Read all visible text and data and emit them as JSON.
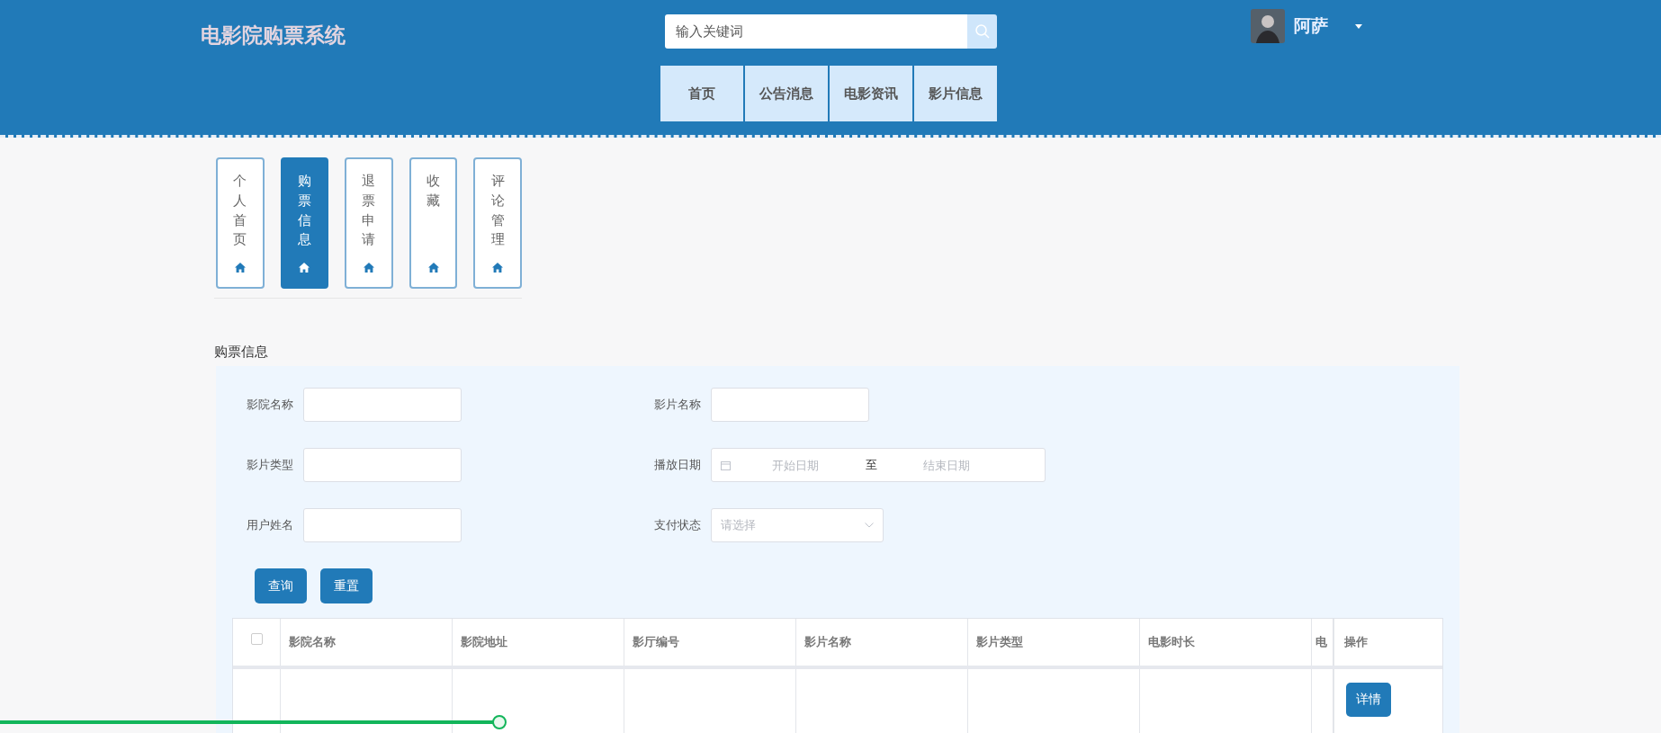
{
  "header": {
    "title": "电影院购票系统",
    "search": {
      "placeholder": "输入关键词"
    },
    "user": {
      "name": "阿萨"
    },
    "nav": [
      {
        "label": "首页"
      },
      {
        "label": "公告消息"
      },
      {
        "label": "电影资讯"
      },
      {
        "label": "影片信息"
      }
    ]
  },
  "side_tabs": [
    {
      "label": "个人首页",
      "selected": false
    },
    {
      "label": "购票信息",
      "selected": true
    },
    {
      "label": "退票申请",
      "selected": false
    },
    {
      "label": "收藏",
      "selected": false
    },
    {
      "label": "评论管理",
      "selected": false
    }
  ],
  "section_title": "购票信息",
  "filters": [
    {
      "label": "影院名称",
      "kind": "text"
    },
    {
      "label": "影片名称",
      "kind": "text"
    },
    {
      "label": "影片类型",
      "kind": "text"
    },
    {
      "label": "播放日期",
      "kind": "daterange",
      "start_placeholder": "开始日期",
      "separator": "至",
      "end_placeholder": "结束日期"
    },
    {
      "label": "用户姓名",
      "kind": "text"
    },
    {
      "label": "支付状态",
      "kind": "select",
      "placeholder": "请选择"
    }
  ],
  "buttons": [
    "查询",
    "重置"
  ],
  "table": {
    "select_all": {
      "checked": false
    },
    "columns": [
      "影院名称",
      "影院地址",
      "影厅编号",
      "影片名称",
      "影片类型",
      "电影时长",
      "电"
    ],
    "action_column": "操作",
    "rows": [
      {
        "action": "详情"
      }
    ]
  },
  "playback": {
    "level": 0.3
  }
}
